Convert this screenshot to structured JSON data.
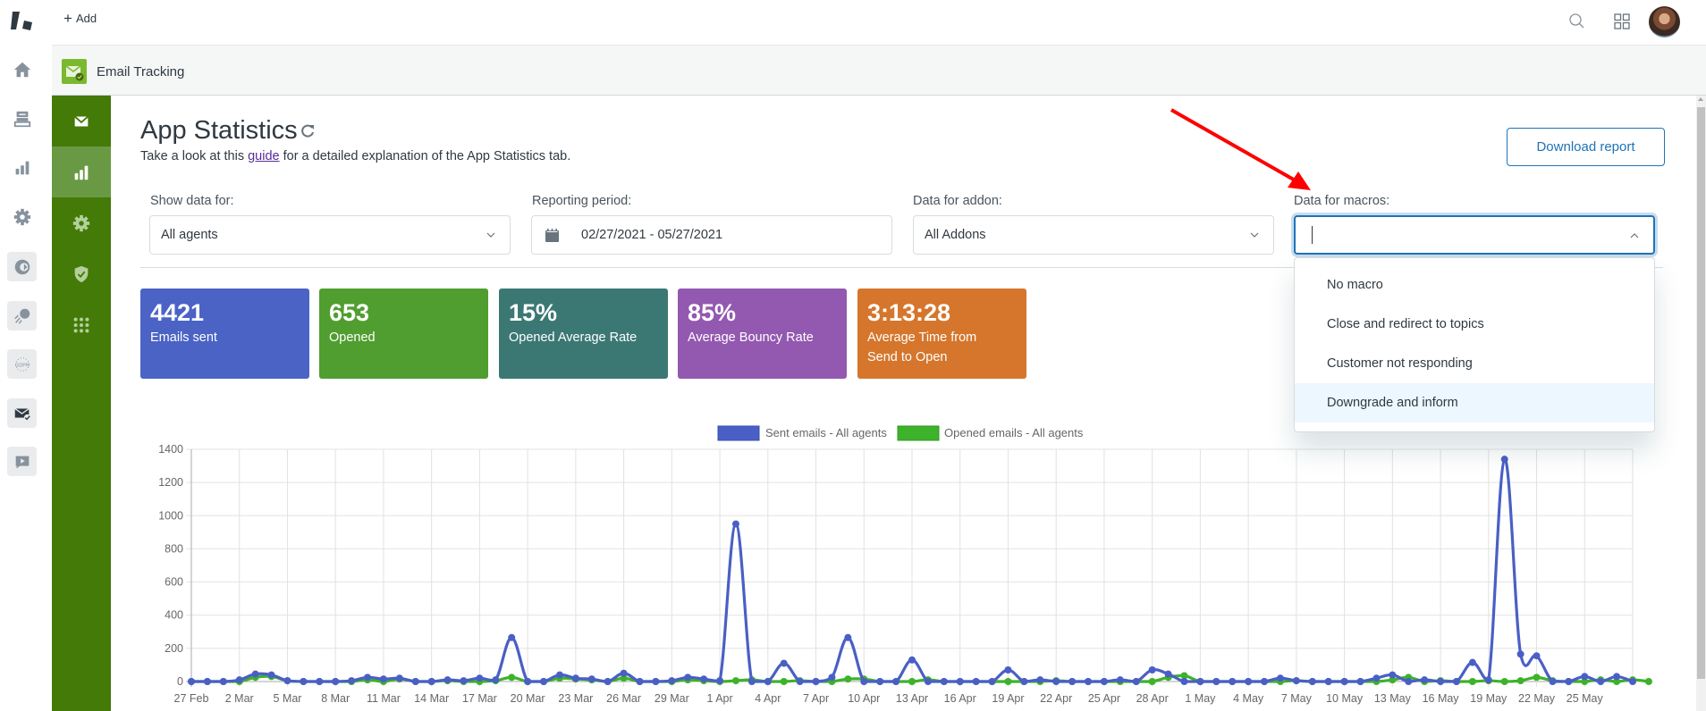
{
  "topbar": {
    "add_label": "Add",
    "icons": [
      "product-logo-icon",
      "search-icon",
      "apps-grid-icon",
      "user-avatar"
    ]
  },
  "rail": {
    "items": [
      "home-icon",
      "tickets-icon",
      "reporting-icon",
      "admin-gear-icon",
      "app-circle-icon",
      "comet-app-icon",
      "gdpr-app-icon",
      "email-tracking-app-icon",
      "video-app-icon"
    ]
  },
  "app_header": {
    "title": "Email Tracking"
  },
  "sidebar": {
    "items": [
      {
        "icon": "envelope-icon",
        "active": false
      },
      {
        "icon": "bar-chart-icon",
        "active": true
      },
      {
        "icon": "gear-icon",
        "active": false
      },
      {
        "icon": "shield-check-icon",
        "active": false
      },
      {
        "icon": "grid-dots-icon",
        "active": false
      }
    ]
  },
  "page": {
    "title": "App Statistics",
    "subtitle_before": "Take a look at this ",
    "subtitle_link": "guide",
    "subtitle_after": " for a detailed explanation of the App Statistics tab.",
    "download_button": "Download report"
  },
  "filters": {
    "show_data_for": {
      "label": "Show data for:",
      "value": "All agents"
    },
    "reporting_period": {
      "label": "Reporting period:",
      "value": "02/27/2021 - 05/27/2021"
    },
    "data_for_addon": {
      "label": "Data for addon:",
      "value": "All Addons"
    },
    "data_for_macros": {
      "label": "Data for macros:",
      "value": "",
      "open": true,
      "options": [
        "No macro",
        "Close and redirect to topics",
        "Customer not responding",
        "Downgrade and inform"
      ],
      "highlighted_index": 3
    }
  },
  "stats": [
    {
      "value": "4421",
      "label": "Emails sent",
      "color": "#4a63c5"
    },
    {
      "value": "653",
      "label": "Opened",
      "color": "#509e2f"
    },
    {
      "value": "15%",
      "label": "Opened Average Rate",
      "color": "#3b7874"
    },
    {
      "value": "85%",
      "label": "Average Bouncy Rate",
      "color": "#9358b0"
    },
    {
      "value": "3:13:28",
      "label": "Average Time from Send to Open",
      "color": "#d5762c"
    }
  ],
  "annotation": {
    "type": "red-arrow",
    "color": "#ff0000",
    "points_to": "data_for_macros"
  },
  "chart_data": {
    "type": "line",
    "title": "",
    "xlabel": "",
    "ylabel": "",
    "ylim": [
      0,
      1400
    ],
    "yticks": [
      0,
      200,
      400,
      600,
      800,
      1000,
      1200,
      1400
    ],
    "grid": true,
    "legend_position": "top-center",
    "x_tick_labels": [
      "27 Feb",
      "2 Mar",
      "5 Mar",
      "8 Mar",
      "11 Mar",
      "14 Mar",
      "17 Mar",
      "20 Mar",
      "23 Mar",
      "26 Mar",
      "29 Mar",
      "1 Apr",
      "4 Apr",
      "7 Apr",
      "10 Apr",
      "13 Apr",
      "16 Apr",
      "19 Apr",
      "22 Apr",
      "25 Apr",
      "28 Apr",
      "1 May",
      "4 May",
      "7 May",
      "10 May",
      "13 May",
      "16 May",
      "19 May",
      "22 May",
      "25 May"
    ],
    "x_start": "27 Feb",
    "x_end": "27 May",
    "series": [
      {
        "name": "Sent emails - All agents",
        "color": "#4a5fc5",
        "values": [
          0,
          0,
          0,
          10,
          45,
          40,
          5,
          0,
          0,
          0,
          5,
          25,
          15,
          20,
          0,
          0,
          10,
          5,
          20,
          10,
          265,
          0,
          0,
          40,
          20,
          15,
          0,
          50,
          0,
          0,
          5,
          25,
          15,
          5,
          950,
          0,
          0,
          110,
          0,
          0,
          25,
          265,
          0,
          0,
          0,
          130,
          0,
          0,
          0,
          0,
          0,
          70,
          0,
          10,
          0,
          0,
          0,
          0,
          10,
          0,
          70,
          45,
          0,
          0,
          0,
          0,
          0,
          0,
          20,
          5,
          0,
          0,
          0,
          0,
          20,
          40,
          0,
          10,
          0,
          0,
          115,
          10,
          1340,
          165,
          155,
          0,
          0,
          30,
          0,
          30,
          0
        ]
      },
      {
        "name": "Opened emails - All agents",
        "color": "#3db22a",
        "values": [
          0,
          0,
          0,
          0,
          25,
          30,
          5,
          0,
          0,
          0,
          0,
          10,
          0,
          15,
          0,
          0,
          5,
          0,
          0,
          5,
          25,
          0,
          0,
          20,
          15,
          10,
          0,
          20,
          0,
          0,
          0,
          10,
          5,
          0,
          5,
          10,
          0,
          0,
          5,
          0,
          0,
          15,
          15,
          0,
          0,
          0,
          10,
          0,
          0,
          0,
          0,
          0,
          0,
          0,
          5,
          0,
          0,
          0,
          0,
          0,
          0,
          25,
          35,
          0,
          0,
          0,
          0,
          0,
          0,
          5,
          0,
          0,
          0,
          0,
          0,
          10,
          25,
          0,
          5,
          0,
          0,
          5,
          0,
          5,
          25,
          5,
          0,
          0,
          10,
          0,
          10,
          0
        ]
      }
    ]
  }
}
